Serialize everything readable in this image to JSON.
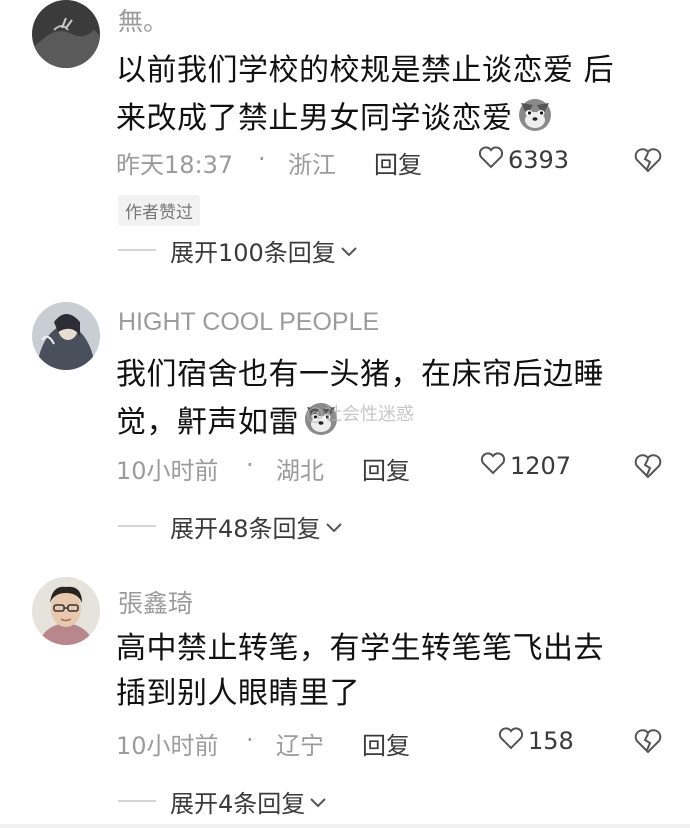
{
  "comments": [
    {
      "username": "無。",
      "lines": [
        "以前我们学校的校规是禁止谈恋爱 后",
        "来改成了禁止男女同学谈恋爱"
      ],
      "emoji": "dog-emoji",
      "time": "昨天18:37",
      "dot": "·",
      "location": "浙江",
      "reply": "回复",
      "likes": "6393",
      "badge": "作者赞过",
      "expand": "展开100条回复"
    },
    {
      "username": "HIGHT COOL PEOPLE",
      "lines": [
        "我们宿舍也有一头猪，在床帘后边睡",
        "觉，鼾声如雷"
      ],
      "emoji": "dog-emoji",
      "time": "10小时前",
      "dot": "·",
      "location": "湖北",
      "reply": "回复",
      "likes": "1207",
      "expand": "展开48条回复"
    },
    {
      "username": "張鑫琦",
      "lines": [
        "高中禁止转笔，有学生转笔笔飞出去",
        "插到别人眼睛里了"
      ],
      "time": "10小时前",
      "dot": "·",
      "location": "辽宁",
      "reply": "回复",
      "likes": "158",
      "expand": "展开4条回复"
    }
  ],
  "watermark": "@社会性迷惑",
  "icons": {
    "like": "heart-outline-icon",
    "dislike": "broken-heart-icon",
    "expand": "chevron-down-icon"
  },
  "colors": {
    "text": "#111111",
    "meta": "#9b9b9b",
    "action": "#3a3a3a"
  }
}
